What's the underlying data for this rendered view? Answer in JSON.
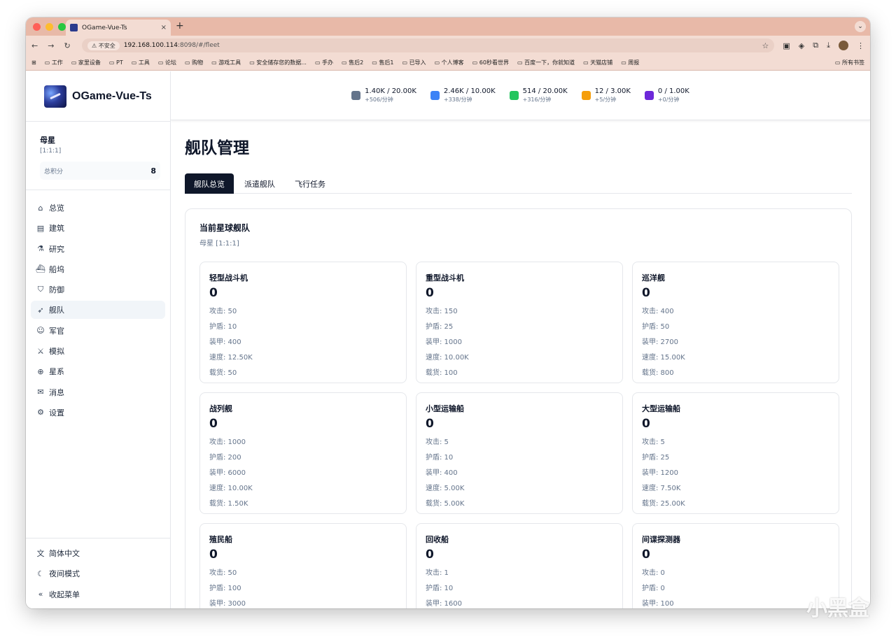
{
  "browser": {
    "tab_title": "OGame-Vue-Ts",
    "tab_close": "×",
    "new_tab": "+",
    "insecure_label": "不安全",
    "url_host": "192.168.100.114",
    "url_path": ":8098/#/fleet",
    "bookmarks": [
      "工作",
      "家里设备",
      "PT",
      "工具",
      "论坛",
      "购物",
      "游戏工具",
      "安全储存您的数据...",
      "手办",
      "售后2",
      "售后1",
      "已导入",
      "个人博客",
      "60秒看世界",
      "百度一下，你就知道",
      "天猫店铺",
      "周报"
    ],
    "bookmarks_right": "所有书签"
  },
  "sidebar": {
    "app_title": "OGame-Vue-Ts",
    "planet_name": "母星",
    "planet_coord": "[1:1:1]",
    "score_label": "总积分",
    "score_value": "8",
    "nav": [
      {
        "label": "总览",
        "icon": "home-icon",
        "glyph": "⌂"
      },
      {
        "label": "建筑",
        "icon": "building-icon",
        "glyph": "▤"
      },
      {
        "label": "研究",
        "icon": "flask-icon",
        "glyph": "⚗"
      },
      {
        "label": "船坞",
        "icon": "shipyard-icon",
        "glyph": "⛴"
      },
      {
        "label": "防御",
        "icon": "shield-icon",
        "glyph": "⛉"
      },
      {
        "label": "舰队",
        "icon": "rocket-icon",
        "glyph": "➶"
      },
      {
        "label": "军官",
        "icon": "users-icon",
        "glyph": "☺"
      },
      {
        "label": "模拟",
        "icon": "swords-icon",
        "glyph": "⚔"
      },
      {
        "label": "星系",
        "icon": "globe-icon",
        "glyph": "⊕"
      },
      {
        "label": "消息",
        "icon": "mail-icon",
        "glyph": "✉"
      },
      {
        "label": "设置",
        "icon": "gear-icon",
        "glyph": "⚙"
      }
    ],
    "bottom": [
      {
        "label": "简体中文",
        "icon": "language-icon",
        "glyph": "文"
      },
      {
        "label": "夜间模式",
        "icon": "moon-icon",
        "glyph": "☾"
      },
      {
        "label": "收起菜单",
        "icon": "collapse-icon",
        "glyph": "«"
      }
    ]
  },
  "resources": [
    {
      "amount": "1.40K / 20.00K",
      "rate": "+506/分钟",
      "color": "#64748b"
    },
    {
      "amount": "2.46K / 10.00K",
      "rate": "+338/分钟",
      "color": "#3b82f6"
    },
    {
      "amount": "514 / 20.00K",
      "rate": "+316/分钟",
      "color": "#22c55e"
    },
    {
      "amount": "12 / 3.00K",
      "rate": "+5/分钟",
      "color": "#f59e0b"
    },
    {
      "amount": "0 / 1.00K",
      "rate": "+0/分钟",
      "color": "#6d28d9"
    }
  ],
  "page": {
    "title": "舰队管理",
    "tabs": [
      "舰队总览",
      "派遣舰队",
      "飞行任务"
    ],
    "panel_title": "当前星球舰队",
    "panel_sub": "母星 [1:1:1]"
  },
  "ships": [
    {
      "name": "轻型战斗机",
      "count": "0",
      "attack": "攻击: 50",
      "shield": "护盾: 10",
      "armor": "装甲: 400",
      "speed": "速度: 12.50K",
      "cargo": "载货: 50"
    },
    {
      "name": "重型战斗机",
      "count": "0",
      "attack": "攻击: 150",
      "shield": "护盾: 25",
      "armor": "装甲: 1000",
      "speed": "速度: 10.00K",
      "cargo": "载货: 100"
    },
    {
      "name": "巡洋舰",
      "count": "0",
      "attack": "攻击: 400",
      "shield": "护盾: 50",
      "armor": "装甲: 2700",
      "speed": "速度: 15.00K",
      "cargo": "载货: 800"
    },
    {
      "name": "战列舰",
      "count": "0",
      "attack": "攻击: 1000",
      "shield": "护盾: 200",
      "armor": "装甲: 6000",
      "speed": "速度: 10.00K",
      "cargo": "载货: 1.50K"
    },
    {
      "name": "小型运输船",
      "count": "0",
      "attack": "攻击: 5",
      "shield": "护盾: 10",
      "armor": "装甲: 400",
      "speed": "速度: 5.00K",
      "cargo": "载货: 5.00K"
    },
    {
      "name": "大型运输船",
      "count": "0",
      "attack": "攻击: 5",
      "shield": "护盾: 25",
      "armor": "装甲: 1200",
      "speed": "速度: 7.50K",
      "cargo": "载货: 25.00K"
    },
    {
      "name": "殖民船",
      "count": "0",
      "attack": "攻击: 50",
      "shield": "护盾: 100",
      "armor": "装甲: 3000",
      "speed": "",
      "cargo": ""
    },
    {
      "name": "回收船",
      "count": "0",
      "attack": "攻击: 1",
      "shield": "护盾: 10",
      "armor": "装甲: 1600",
      "speed": "",
      "cargo": ""
    },
    {
      "name": "间谍探测器",
      "count": "0",
      "attack": "攻击: 0",
      "shield": "护盾: 0",
      "armor": "装甲: 100",
      "speed": "",
      "cargo": ""
    }
  ],
  "watermark": "小黑盒"
}
